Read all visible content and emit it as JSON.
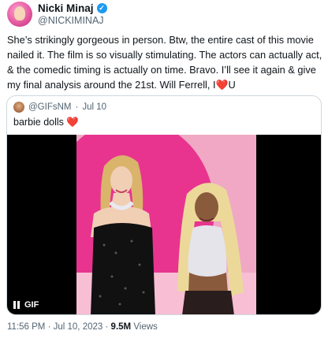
{
  "author": {
    "name": "Nicki Minaj",
    "handle": "@NICKIMINAJ"
  },
  "tweet": {
    "text_main": "She’s strikingly gorgeous in person. Btw, the entire cast of this movie nailed it. The film is so visually stimulating. The actors can actually act, & the comedic timing is actually on time. Bravo. I’ll see it again & give my final analysis around the 21st. Will Ferrell, I",
    "text_heart": "❤️",
    "text_tail": "U"
  },
  "quote": {
    "handle": "@GIFsNM",
    "separator": "·",
    "date": "Jul 10",
    "text": "barbie dolls",
    "text_heart": "❤️",
    "media": {
      "gif_label": "GIF",
      "pause_icon": "pause-icon"
    }
  },
  "meta": {
    "time": "11:56 PM",
    "sep1": "·",
    "date": "Jul 10, 2023",
    "sep2": "·",
    "views_count": "9.5M",
    "views_label": "Views"
  },
  "colors": {
    "verified": "#1d9bf0",
    "secondary_text": "#536471",
    "border": "#cfd9de",
    "heart": "#e0245e"
  }
}
